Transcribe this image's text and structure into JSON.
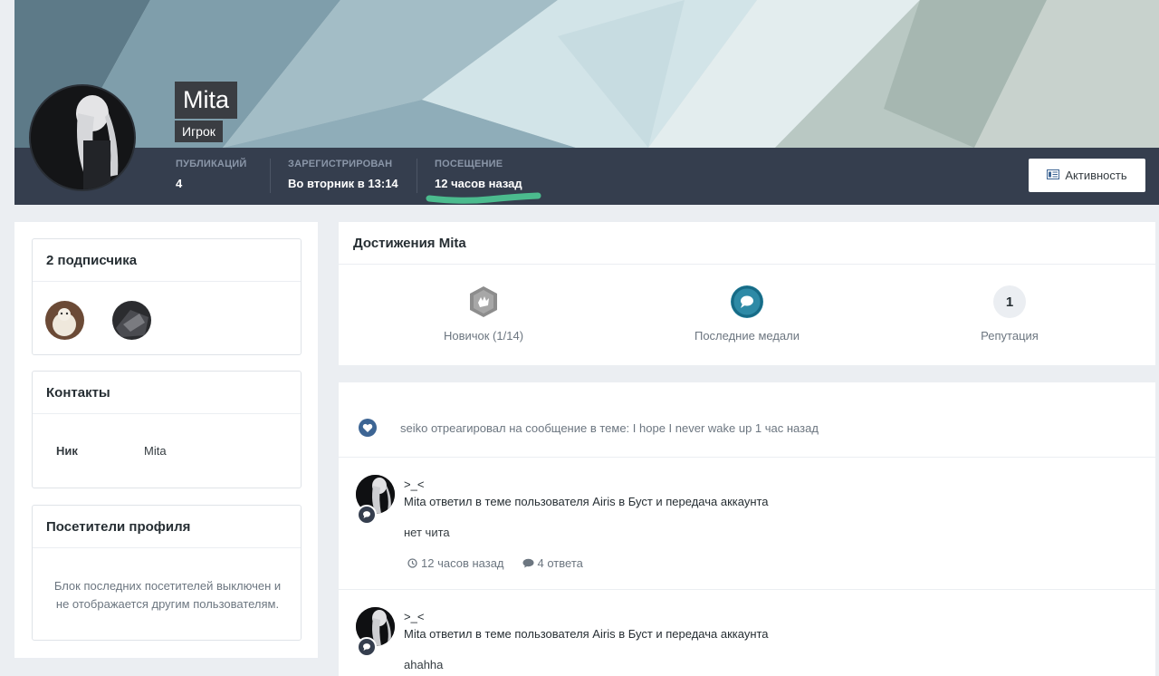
{
  "profile": {
    "name": "Mita",
    "role": "Игрок",
    "stats": [
      {
        "label": "ПУБЛИКАЦИЙ",
        "value": "4"
      },
      {
        "label": "ЗАРЕГИСТРИРОВАН",
        "value": "Во вторник в 13:14"
      },
      {
        "label": "ПОСЕЩЕНИЕ",
        "value": "12 часов назад"
      }
    ],
    "activity_button": "Активность"
  },
  "sidebar": {
    "followers": {
      "title": "2 подписчика"
    },
    "contacts": {
      "title": "Контакты",
      "label": "Ник",
      "value": "Mita"
    },
    "visitors": {
      "title": "Посетители профиля",
      "text": "Блок последних посетителей выключен и не отображается другим пользователям."
    }
  },
  "achievements": {
    "title": "Достижения Mita",
    "items": [
      {
        "label": "Новичок (1/14)",
        "icon": "rank-badge-icon"
      },
      {
        "label": "Последние медали",
        "icon": "chat-bubble-icon"
      },
      {
        "label": "Репутация",
        "value": "1"
      }
    ]
  },
  "feed": {
    "reaction": "seiko отреагировал на сообщение в теме: I hope I never wake up 1 час назад",
    "posts": [
      {
        "title": ">_<",
        "line": "Mita ответил в теме пользователя Airis в Буст и передача аккаунта",
        "body": "нет чита",
        "time": "12 часов назад",
        "replies": "4 ответа"
      },
      {
        "title": ">_<",
        "line": "Mita ответил в теме пользователя Airis в Буст и передача аккаунта",
        "body": "ahahha"
      }
    ]
  },
  "colors": {
    "accent": "#3d6594",
    "statbar": "#353e4e",
    "highlight": "#2e8aa6"
  }
}
